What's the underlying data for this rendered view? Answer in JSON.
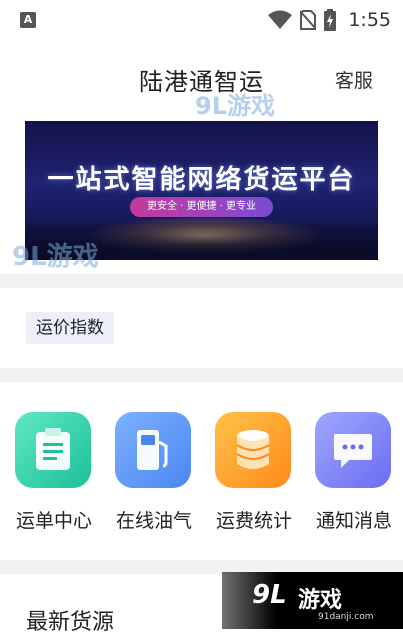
{
  "status_bar": {
    "badge": "A",
    "time": "1:55"
  },
  "header": {
    "title": "陆港通智运",
    "service_label": "客服"
  },
  "watermarks": {
    "top_logo": "9L游戏",
    "left_logo": "9L游戏",
    "corner_logo": "9L",
    "corner_text": "游戏",
    "corner_url": "91danji.com"
  },
  "banner": {
    "headline": "一站式智能网络货运平台",
    "slogan": "更安全 · 更便捷 · 更专业"
  },
  "freight_index": {
    "label": "运价指数"
  },
  "features": [
    {
      "label": "运单中心",
      "icon": "clipboard-icon",
      "color": "#1dc19a"
    },
    {
      "label": "在线油气",
      "icon": "fuel-pump-icon",
      "color": "#4a86f0"
    },
    {
      "label": "运费统计",
      "icon": "coin-stack-icon",
      "color": "#ff8a1a"
    },
    {
      "label": "通知消息",
      "icon": "message-icon",
      "color": "#6b6cf2"
    }
  ],
  "latest_cargo": {
    "title": "最新货源"
  }
}
